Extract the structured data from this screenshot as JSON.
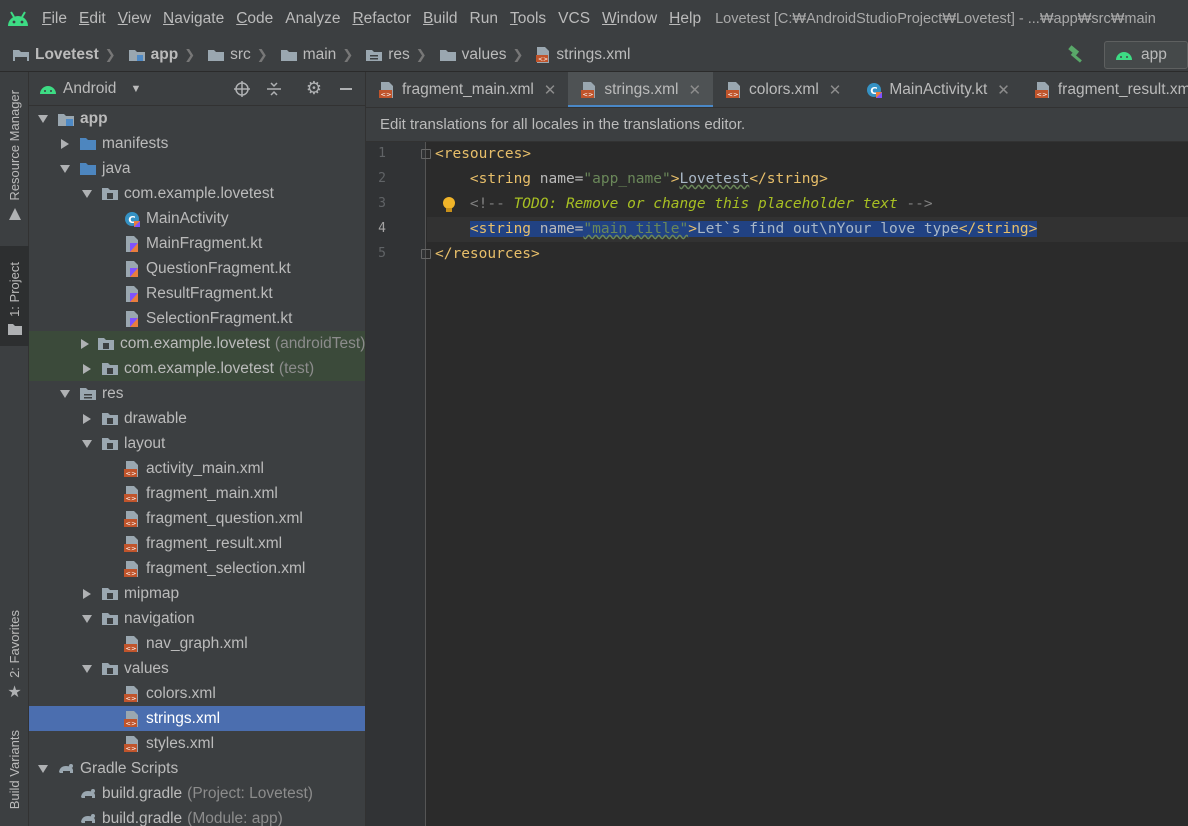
{
  "menubar": {
    "items": [
      {
        "label": "File",
        "mnemonic": "F",
        "rest": "ile"
      },
      {
        "label": "Edit",
        "mnemonic": "E",
        "rest": "dit"
      },
      {
        "label": "View",
        "mnemonic": "V",
        "rest": "iew"
      },
      {
        "label": "Navigate",
        "mnemonic": "N",
        "rest": "avigate"
      },
      {
        "label": "Code",
        "mnemonic": "C",
        "rest": "ode"
      },
      {
        "label": "Analyze",
        "mnemonic": "",
        "rest": "Analyze"
      },
      {
        "label": "Refactor",
        "mnemonic": "R",
        "rest": "efactor"
      },
      {
        "label": "Build",
        "mnemonic": "B",
        "rest": "uild"
      },
      {
        "label": "Run",
        "mnemonic": "",
        "rest": "Run"
      },
      {
        "label": "Tools",
        "mnemonic": "T",
        "rest": "ools"
      },
      {
        "label": "VCS",
        "mnemonic": "",
        "rest": "VCS"
      },
      {
        "label": "Window",
        "mnemonic": "W",
        "rest": "indow"
      },
      {
        "label": "Help",
        "mnemonic": "H",
        "rest": "elp"
      }
    ],
    "window_title": "Lovetest [C:₩AndroidStudioProject₩Lovetest] - ...₩app₩src₩main"
  },
  "breadcrumb": {
    "items": [
      "Lovetest",
      "app",
      "src",
      "main",
      "res",
      "values",
      "strings.xml"
    ]
  },
  "run_config": {
    "label": "app"
  },
  "left_strip": {
    "resource_manager": "Resource Manager",
    "project": "1: Project",
    "favorites": "2: Favorites",
    "build_variants": "Build Variants"
  },
  "project_panel": {
    "view_mode": "Android",
    "tree": [
      {
        "label": "app",
        "suffix": "",
        "depth": 0,
        "arrow": "down",
        "icon": "module"
      },
      {
        "label": "manifests",
        "suffix": "",
        "depth": 1,
        "arrow": "right",
        "icon": "folder-blue"
      },
      {
        "label": "java",
        "suffix": "",
        "depth": 1,
        "arrow": "down",
        "icon": "folder-blue"
      },
      {
        "label": "com.example.lovetest",
        "suffix": "",
        "depth": 2,
        "arrow": "down",
        "icon": "package"
      },
      {
        "label": "MainActivity",
        "suffix": "",
        "depth": 3,
        "arrow": "",
        "icon": "kotlin-class"
      },
      {
        "label": "MainFragment.kt",
        "suffix": "",
        "depth": 3,
        "arrow": "",
        "icon": "kotlin-file"
      },
      {
        "label": "QuestionFragment.kt",
        "suffix": "",
        "depth": 3,
        "arrow": "",
        "icon": "kotlin-file"
      },
      {
        "label": "ResultFragment.kt",
        "suffix": "",
        "depth": 3,
        "arrow": "",
        "icon": "kotlin-file"
      },
      {
        "label": "SelectionFragment.kt",
        "suffix": "",
        "depth": 3,
        "arrow": "",
        "icon": "kotlin-file"
      },
      {
        "label": "com.example.lovetest",
        "suffix": "(androidTest)",
        "depth": 2,
        "arrow": "right",
        "icon": "package"
      },
      {
        "label": "com.example.lovetest",
        "suffix": "(test)",
        "depth": 2,
        "arrow": "right",
        "icon": "package"
      },
      {
        "label": "res",
        "suffix": "",
        "depth": 1,
        "arrow": "down",
        "icon": "folder-res"
      },
      {
        "label": "drawable",
        "suffix": "",
        "depth": 2,
        "arrow": "right",
        "icon": "package"
      },
      {
        "label": "layout",
        "suffix": "",
        "depth": 2,
        "arrow": "down",
        "icon": "package"
      },
      {
        "label": "activity_main.xml",
        "suffix": "",
        "depth": 3,
        "arrow": "",
        "icon": "xml"
      },
      {
        "label": "fragment_main.xml",
        "suffix": "",
        "depth": 3,
        "arrow": "",
        "icon": "xml"
      },
      {
        "label": "fragment_question.xml",
        "suffix": "",
        "depth": 3,
        "arrow": "",
        "icon": "xml"
      },
      {
        "label": "fragment_result.xml",
        "suffix": "",
        "depth": 3,
        "arrow": "",
        "icon": "xml"
      },
      {
        "label": "fragment_selection.xml",
        "suffix": "",
        "depth": 3,
        "arrow": "",
        "icon": "xml"
      },
      {
        "label": "mipmap",
        "suffix": "",
        "depth": 2,
        "arrow": "right",
        "icon": "package"
      },
      {
        "label": "navigation",
        "suffix": "",
        "depth": 2,
        "arrow": "down",
        "icon": "package"
      },
      {
        "label": "nav_graph.xml",
        "suffix": "",
        "depth": 3,
        "arrow": "",
        "icon": "xml"
      },
      {
        "label": "values",
        "suffix": "",
        "depth": 2,
        "arrow": "down",
        "icon": "package"
      },
      {
        "label": "colors.xml",
        "suffix": "",
        "depth": 3,
        "arrow": "",
        "icon": "xml"
      },
      {
        "label": "strings.xml",
        "suffix": "",
        "depth": 3,
        "arrow": "",
        "icon": "xml",
        "selected": true
      },
      {
        "label": "styles.xml",
        "suffix": "",
        "depth": 3,
        "arrow": "",
        "icon": "xml"
      },
      {
        "label": "Gradle Scripts",
        "suffix": "",
        "depth": 0,
        "arrow": "down",
        "icon": "gradle"
      },
      {
        "label": "build.gradle",
        "suffix": "(Project: Lovetest)",
        "depth": 1,
        "arrow": "",
        "icon": "gradle"
      },
      {
        "label": "build.gradle",
        "suffix": "(Module: app)",
        "depth": 1,
        "arrow": "",
        "icon": "gradle"
      }
    ]
  },
  "tabs": [
    {
      "label": "fragment_main.xml",
      "icon": "xml",
      "active": false
    },
    {
      "label": "strings.xml",
      "icon": "xml",
      "active": true
    },
    {
      "label": "colors.xml",
      "icon": "xml",
      "active": false
    },
    {
      "label": "MainActivity.kt",
      "icon": "kotlin-class",
      "active": false
    },
    {
      "label": "fragment_result.xml",
      "icon": "xml",
      "active": false
    }
  ],
  "banner": {
    "text": "Edit translations for all locales in the translations editor."
  },
  "editor": {
    "current_line": 4,
    "line_numbers": [
      "1",
      "2",
      "3",
      "4",
      "5"
    ],
    "lines": [
      [
        {
          "t": "tag",
          "s": "<resources>"
        }
      ],
      [
        {
          "t": "ws",
          "s": "    "
        },
        {
          "t": "tag",
          "s": "<string "
        },
        {
          "t": "attr",
          "s": "name="
        },
        {
          "t": "val",
          "s": "\"app_name\""
        },
        {
          "t": "tag",
          "s": ">"
        },
        {
          "t": "txt-squig",
          "s": "Lovetest"
        },
        {
          "t": "tag",
          "s": "</string>"
        }
      ],
      [
        {
          "t": "ws",
          "s": "    "
        },
        {
          "t": "cmt",
          "s": "<!-- "
        },
        {
          "t": "todo",
          "s": "TODO: Remove or change this placeholder text"
        },
        {
          "t": "cmt",
          "s": " -->"
        }
      ],
      [
        {
          "t": "ws",
          "s": "    "
        },
        {
          "t": "tag-sel",
          "s": "<string "
        },
        {
          "t": "attr-sel",
          "s": "name="
        },
        {
          "t": "val-sel",
          "s": "\"main_title\""
        },
        {
          "t": "tag-sel",
          "s": ">"
        },
        {
          "t": "txt-sel",
          "s": "Let`s find out\\nYour love type"
        },
        {
          "t": "tag-sel",
          "s": "</string>"
        }
      ],
      [
        {
          "t": "tag",
          "s": "</resources>"
        }
      ]
    ]
  },
  "colors": {
    "selection": "#4b6eaf",
    "tab_underline": "#4a88c7",
    "android_green": "#3ddc84",
    "xml_tag": "#e8bf6a",
    "string_value": "#6a8759"
  }
}
